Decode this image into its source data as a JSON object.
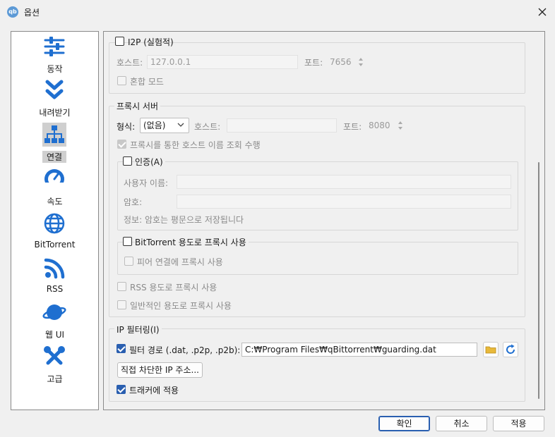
{
  "window": {
    "title": "옵션",
    "app_icon_text": "qb"
  },
  "sidebar": {
    "items": [
      {
        "label": "동작",
        "icon": "sliders-icon"
      },
      {
        "label": "내려받기",
        "icon": "chevrons-down-icon"
      },
      {
        "label": "연결",
        "icon": "network-icon",
        "selected": true
      },
      {
        "label": "속도",
        "icon": "speedometer-icon"
      },
      {
        "label": "BitTorrent",
        "icon": "globe-icon"
      },
      {
        "label": "RSS",
        "icon": "rss-icon"
      },
      {
        "label": "웹 UI",
        "icon": "planet-icon"
      },
      {
        "label": "고급",
        "icon": "tools-icon"
      }
    ]
  },
  "i2p": {
    "checkbox_label": "I2P (실험적)",
    "host_label": "호스트:",
    "host_value": "127.0.0.1",
    "port_label": "포트:",
    "port_value": "7656",
    "mixed_mode_label": "혼합 모드"
  },
  "proxy": {
    "group_title": "프록시 서버",
    "type_label": "형식:",
    "type_value": "(없음)",
    "host_label": "호스트:",
    "host_value": "",
    "port_label": "포트:",
    "port_value": "8080",
    "hostname_lookup_label": "프록시를 통한 호스트 이름 조회 수행",
    "auth_label": "인증(A)",
    "username_label": "사용자 이름:",
    "password_label": "암호:",
    "auth_info": "정보: 암호는 평문으로 저장됩니다",
    "bittorrent_label": "BitTorrent 용도로 프록시 사용",
    "peer_label": "피어 연결에 프록시 사용",
    "rss_label": "RSS 용도로 프록시 사용",
    "general_label": "일반적인 용도로 프록시 사용"
  },
  "ip_filter": {
    "group_title": "IP 필터링(I)",
    "filter_path_label": "필터 경로 (.dat, .p2p, .p2b):",
    "filter_path_value": "C:₩Program Files₩qBittorrent₩guarding.dat",
    "banned_ips_button": "직접 차단한 IP 주소...",
    "apply_trackers_label": "트래커에 적용"
  },
  "footer": {
    "ok": "확인",
    "cancel": "취소",
    "apply": "적용"
  },
  "colors": {
    "accent": "#2a5fb0",
    "icon_blue": "#1f6fd0"
  }
}
